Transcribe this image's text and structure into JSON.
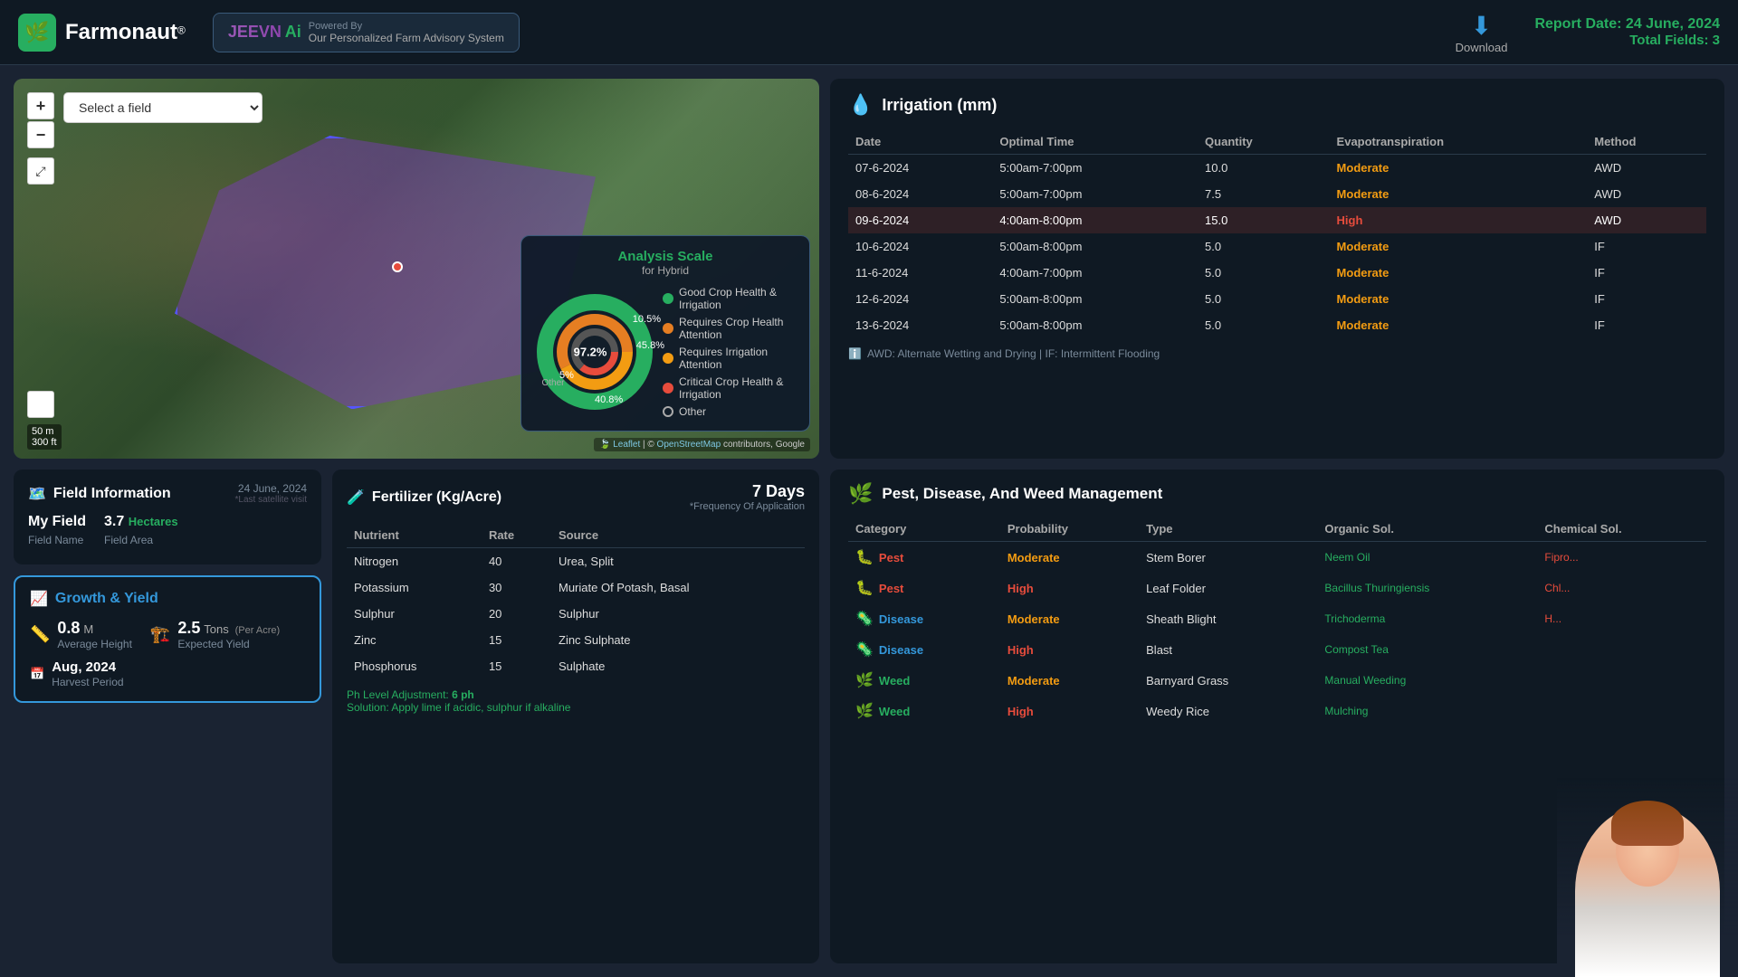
{
  "header": {
    "logo_text": "Farmonaut",
    "logo_reg": "®",
    "jeevn_label": "JEEVN",
    "ai_label": "Ai",
    "powered_by": "Powered By",
    "powered_sub": "Our Personalized Farm Advisory System",
    "download_label": "Download",
    "report_date_label": "Report Date:",
    "report_date_value": "24 June, 2024",
    "total_fields_label": "Total Fields:",
    "total_fields_value": "3"
  },
  "map": {
    "field_select_placeholder": "Select a field",
    "zoom_in": "+",
    "zoom_out": "−",
    "scale_m": "50 m",
    "scale_ft": "300 ft",
    "attribution": "Leaflet | © OpenStreetMap contributors, Google"
  },
  "analysis_scale": {
    "title": "Analysis Scale",
    "subtitle": "for Hybrid",
    "label_97": "97.2%",
    "label_10": "10.5%",
    "label_45": "45.8%",
    "label_5": "5%",
    "label_other": "Other",
    "label_40": "40.8%",
    "legend": [
      {
        "color": "#27ae60",
        "label": "Good Crop Health & Irrigation"
      },
      {
        "color": "#e67e22",
        "label": "Requires Crop Health Attention"
      },
      {
        "color": "#f39c12",
        "label": "Requires Irrigation Attention"
      },
      {
        "color": "#e74c3c",
        "label": "Critical Crop Health & Irrigation"
      },
      {
        "color": "transparent",
        "label": "Other",
        "circle": true
      }
    ]
  },
  "irrigation": {
    "title": "Irrigation (mm)",
    "icon": "💧",
    "columns": [
      "Date",
      "Optimal Time",
      "Quantity",
      "Evapotranspiration",
      "Method"
    ],
    "rows": [
      {
        "date": "07-6-2024",
        "time": "5:00am-7:00pm",
        "qty": "10.0",
        "et": "Moderate",
        "method": "AWD",
        "highlight": false
      },
      {
        "date": "08-6-2024",
        "time": "5:00am-7:00pm",
        "qty": "7.5",
        "et": "Moderate",
        "method": "AWD",
        "highlight": false
      },
      {
        "date": "09-6-2024",
        "time": "4:00am-8:00pm",
        "qty": "15.0",
        "et": "High",
        "method": "AWD",
        "highlight": true
      },
      {
        "date": "10-6-2024",
        "time": "5:00am-8:00pm",
        "qty": "5.0",
        "et": "Moderate",
        "method": "IF",
        "highlight": false
      },
      {
        "date": "11-6-2024",
        "time": "4:00am-7:00pm",
        "qty": "5.0",
        "et": "Moderate",
        "method": "IF",
        "highlight": false
      },
      {
        "date": "12-6-2024",
        "time": "5:00am-8:00pm",
        "qty": "5.0",
        "et": "Moderate",
        "method": "IF",
        "highlight": false
      },
      {
        "date": "13-6-2024",
        "time": "5:00am-8:00pm",
        "qty": "5.0",
        "et": "Moderate",
        "method": "IF",
        "highlight": false
      }
    ],
    "note": "AWD: Alternate Wetting and Drying | IF: Intermittent Flooding"
  },
  "field_info": {
    "title": "Field Information",
    "icon": "🗺️",
    "date": "24 June, 2024",
    "date_sub": "*Last satellite visit",
    "field_name_label": "My Field",
    "field_name_sub": "Field Name",
    "area_value": "3.7",
    "area_unit": "Hectares",
    "area_label": "Field Area"
  },
  "growth": {
    "title": "Growth & Yield",
    "icon": "📈",
    "height_value": "0.8",
    "height_unit": "M",
    "height_label": "Average Height",
    "yield_value": "2.5",
    "yield_unit": "Tons",
    "yield_per": "(Per Acre)",
    "yield_label": "Expected Yield",
    "harvest_value": "Aug, 2024",
    "harvest_label": "Harvest Period"
  },
  "fertilizer": {
    "title": "Fertilizer (Kg/Acre)",
    "icon": "🧪",
    "freq_days": "7 Days",
    "freq_label": "*Frequency Of Application",
    "columns": [
      "Nutrient",
      "Rate",
      "Source"
    ],
    "rows": [
      {
        "nutrient": "Nitrogen",
        "rate": "40",
        "source": "Urea, Split"
      },
      {
        "nutrient": "Potassium",
        "rate": "30",
        "source": "Muriate Of Potash, Basal"
      },
      {
        "nutrient": "Sulphur",
        "rate": "20",
        "source": "Sulphur"
      },
      {
        "nutrient": "Zinc",
        "rate": "15",
        "source": "Zinc Sulphate"
      },
      {
        "nutrient": "Phosphorus",
        "rate": "15",
        "source": "Sulphate"
      }
    ],
    "ph_label": "Ph Level Adjustment:",
    "ph_value": "6 ph",
    "solution_label": "Solution:",
    "solution_value": "Apply lime if acidic, sulphur if alkaline"
  },
  "pest": {
    "title": "Pest, Disease, And Weed Management",
    "icon": "🌿",
    "columns": [
      "Category",
      "Probability",
      "Type",
      "Organic Sol.",
      "Chemical Sol."
    ],
    "rows": [
      {
        "category": "Pest",
        "cat_color": "pest",
        "probability": "Moderate",
        "prob_level": "moderate",
        "type": "Stem Borer",
        "organic": "Neem Oil",
        "chemical": "Fipro..."
      },
      {
        "category": "Pest",
        "cat_color": "pest",
        "probability": "High",
        "prob_level": "high",
        "type": "Leaf Folder",
        "organic": "Bacillus Thuringiensis",
        "chemical": "Chl..."
      },
      {
        "category": "Disease",
        "cat_color": "disease",
        "probability": "Moderate",
        "prob_level": "moderate",
        "type": "Sheath Blight",
        "organic": "Trichoderma",
        "chemical": "H..."
      },
      {
        "category": "Disease",
        "cat_color": "disease",
        "probability": "High",
        "prob_level": "high",
        "type": "Blast",
        "organic": "Compost Tea",
        "chemical": ""
      },
      {
        "category": "Weed",
        "cat_color": "weed",
        "probability": "Moderate",
        "prob_level": "moderate",
        "type": "Barnyard Grass",
        "organic": "Manual Weeding",
        "chemical": ""
      },
      {
        "category": "Weed",
        "cat_color": "weed",
        "probability": "High",
        "prob_level": "high",
        "type": "Weedy Rice",
        "organic": "Mulching",
        "chemical": ""
      }
    ]
  }
}
